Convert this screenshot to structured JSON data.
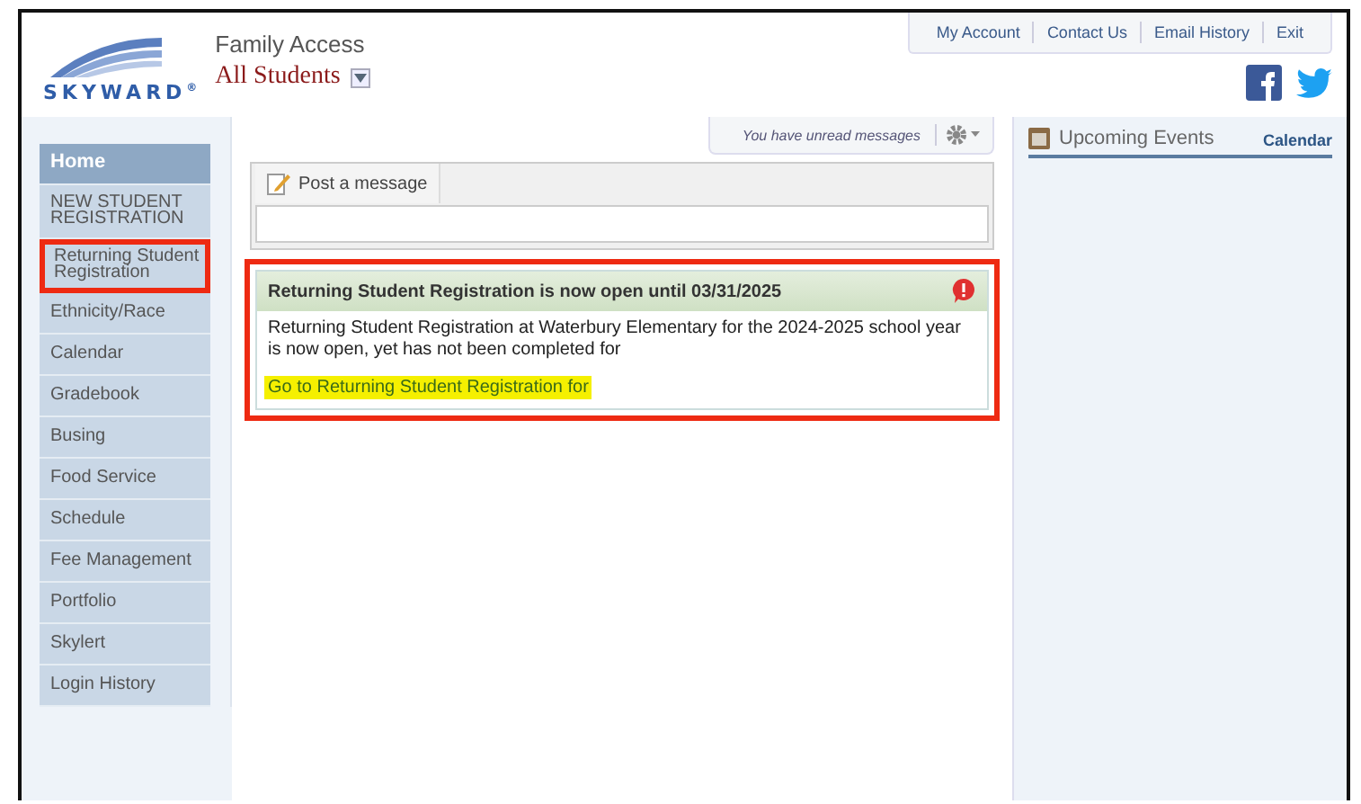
{
  "header": {
    "logo_text": "SKYWARD",
    "logo_mark": "®",
    "app_title": "Family Access",
    "student_selector": "All Students"
  },
  "top_links": [
    "My Account",
    "Contact Us",
    "Email History",
    "Exit"
  ],
  "sidebar": {
    "items": [
      {
        "label": "Home",
        "selected": true,
        "highlighted": false
      },
      {
        "label": "NEW STUDENT REGISTRATION",
        "selected": false,
        "highlighted": false
      },
      {
        "label": "Returning Student Registration",
        "selected": false,
        "highlighted": true
      },
      {
        "label": "Ethnicity/Race",
        "selected": false,
        "highlighted": false
      },
      {
        "label": "Calendar",
        "selected": false,
        "highlighted": false
      },
      {
        "label": "Gradebook",
        "selected": false,
        "highlighted": false
      },
      {
        "label": "Busing",
        "selected": false,
        "highlighted": false
      },
      {
        "label": "Food Service",
        "selected": false,
        "highlighted": false
      },
      {
        "label": "Schedule",
        "selected": false,
        "highlighted": false
      },
      {
        "label": "Fee Management",
        "selected": false,
        "highlighted": false
      },
      {
        "label": "Portfolio",
        "selected": false,
        "highlighted": false
      },
      {
        "label": "Skylert",
        "selected": false,
        "highlighted": false
      },
      {
        "label": "Login History",
        "selected": false,
        "highlighted": false
      }
    ]
  },
  "messages_bar": {
    "text": "You have unread messages"
  },
  "post_box": {
    "tab": "Post a message"
  },
  "notice": {
    "highlighted": true,
    "title": "Returning Student Registration is now open until 03/31/2025",
    "body": "Returning Student Registration at Waterbury Elementary for the 2024-2025 school year is now open, yet has not been completed for",
    "link": "Go to Returning Student Registration for",
    "link_highlighted": true
  },
  "events": {
    "title": "Upcoming Events",
    "link": "Calendar"
  }
}
